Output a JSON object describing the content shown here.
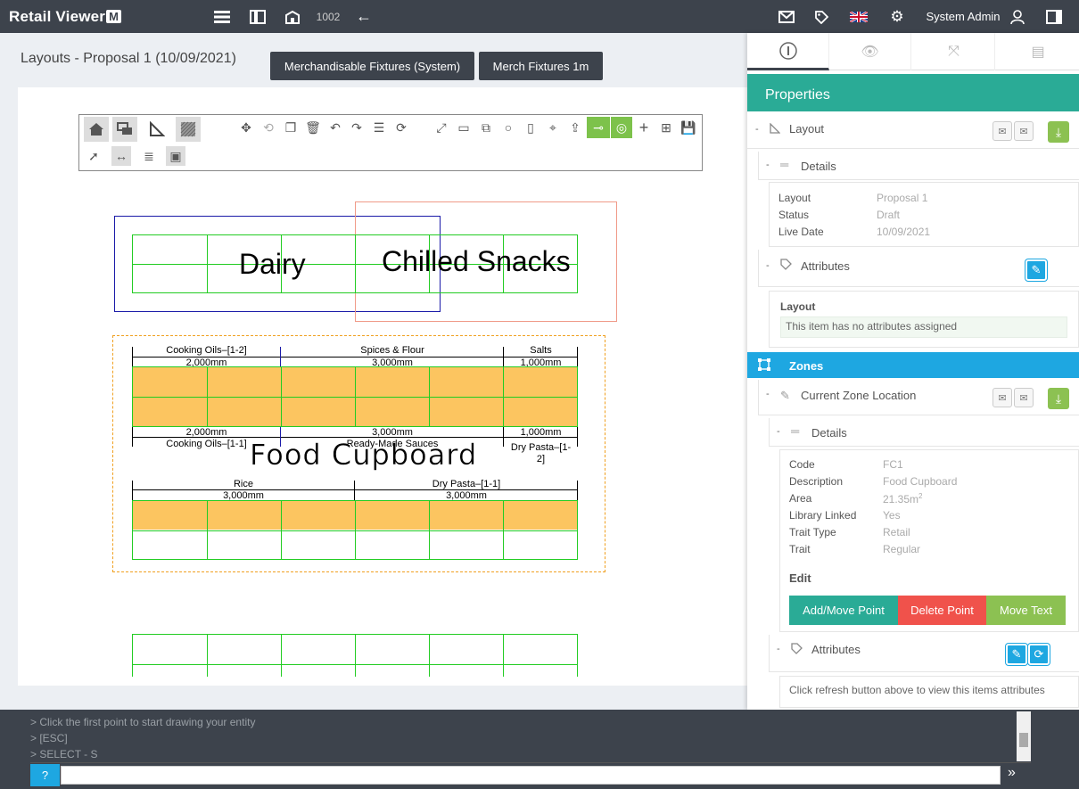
{
  "app": {
    "logo_text": "Retail Viewer",
    "logo_badge": "M",
    "counter": "1002",
    "user_name": "System Admin"
  },
  "page": {
    "title": "Layouts - Proposal 1 (10/09/2021)",
    "btn_fixtures": "Merchandisable Fixtures (System)",
    "btn_merch": "Merch Fixtures 1m"
  },
  "drawing": {
    "zone_dairy": "Dairy",
    "zone_chilled": "Chilled Snacks",
    "zone_food": "Food Cupboard",
    "labels_top": {
      "cooking_oils": "Cooking Oils–[1-2]",
      "spices": "Spices & Flour",
      "salts": "Salts"
    },
    "dims_top": {
      "a": "2,000mm",
      "b": "3,000mm",
      "c": "1,000mm"
    },
    "dims_mid": {
      "a": "2,000mm",
      "b": "3,000mm",
      "c": "1,000mm"
    },
    "labels_mid": {
      "cooking_oils": "Cooking Oils–[1-1]",
      "sauces": "Ready-Made Sauces",
      "dry_pasta_a": "Dry Pasta–[1-",
      "dry_pasta_b": "2]"
    },
    "labels_low": {
      "rice": "Rice",
      "dry_pasta": "Dry Pasta–[1-1]"
    },
    "dims_low": {
      "a": "3,000mm",
      "b": "3,000mm"
    }
  },
  "panel": {
    "title": "Properties",
    "layout_section": "Layout",
    "details_label": "Details",
    "layout_details": [
      {
        "k": "Layout",
        "v": "Proposal 1"
      },
      {
        "k": "Status",
        "v": "Draft"
      },
      {
        "k": "Live Date",
        "v": "10/09/2021"
      }
    ],
    "attributes_label": "Attributes",
    "attr_layout_title": "Layout",
    "attr_none": "This item has no attributes assigned",
    "zones_label": "Zones",
    "zone_location": "Current Zone Location",
    "zone_details": [
      {
        "k": "Code",
        "v": "FC1"
      },
      {
        "k": "Description",
        "v": "Food Cupboard"
      },
      {
        "k": "Area",
        "v": "21.35m"
      },
      {
        "k": "Library Linked",
        "v": "Yes"
      },
      {
        "k": "Trait Type",
        "v": "Retail"
      },
      {
        "k": "Trait",
        "v": "Regular"
      }
    ],
    "area_sup": "2",
    "edit_label": "Edit",
    "btn_add_move": "Add/Move Point",
    "btn_delete": "Delete Point",
    "btn_move_text": "Move Text",
    "attr_hint": "Click refresh button above to view this items attributes"
  },
  "console": {
    "lines": [
      "> Click the first point to start drawing your entity",
      "> [ESC]",
      "> SELECT - S"
    ],
    "input_value": ""
  },
  "colors": {
    "topbar": "#3d434c",
    "teal": "#2aab96",
    "blue": "#1ea7e1",
    "red": "#f0524b",
    "green": "#8cc152",
    "shelf_orange": "#fcc560"
  }
}
